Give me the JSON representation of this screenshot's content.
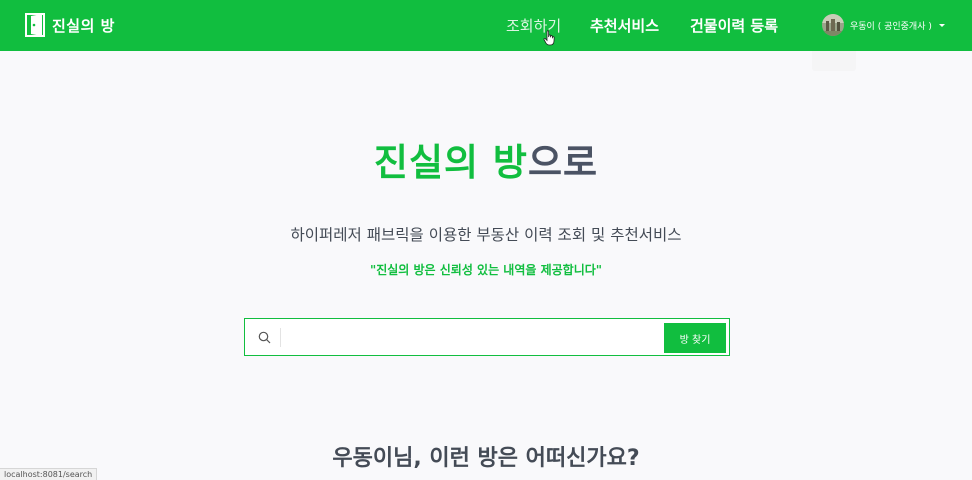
{
  "header": {
    "brand": "진실의 방",
    "nav": {
      "search": "조회하기",
      "recommend": "추천서비스",
      "register": "건물이력 등록"
    },
    "user": {
      "name": "우동이 ( 공인중개사 )"
    }
  },
  "hero": {
    "title_highlight": "진실의 방",
    "title_rest": "으로",
    "subtitle": "하이퍼레저 패브릭을 이용한 부동산 이력 조회 및 추천서비스",
    "tagline": "\"진실의 방은 신뢰성 있는 내역을 제공합니다\""
  },
  "search": {
    "value": "",
    "button_label": "방 찾기"
  },
  "recommend_section": {
    "heading": "우동이님, 이런 방은 어떠신가요?"
  },
  "status_bar": {
    "url": "localhost:8081/search"
  },
  "colors": {
    "brand_green": "#11be3f",
    "text_dark": "#4b5364",
    "background": "#f9f9fb"
  },
  "icons": {
    "brand": "door-logo-icon",
    "search": "search-icon",
    "user_menu": "caret-down-icon",
    "pointer": "hand-cursor-icon"
  }
}
